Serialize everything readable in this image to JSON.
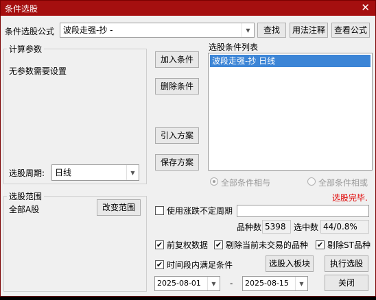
{
  "window": {
    "title": "条件选股",
    "close_glyph": "✕"
  },
  "formula": {
    "label": "条件选股公式",
    "value": "波段走强-抄  -",
    "find_button": "查找",
    "usage_button": "用法注释",
    "view_button": "查看公式"
  },
  "params": {
    "group_label": "计算参数",
    "none_text": "无参数需要设置",
    "period_label": "选股周期:",
    "period_value": "日线"
  },
  "actions": {
    "add_condition": "加入条件",
    "delete_condition": "删除条件",
    "import_plan": "引入方案",
    "save_plan": "保存方案"
  },
  "conditions": {
    "list_label": "选股条件列表",
    "items": [
      "波段走强-抄  日线"
    ],
    "all_and": "全部条件相与",
    "all_or": "全部条件相或",
    "status": "选股完毕."
  },
  "range": {
    "group_label": "选股范围",
    "value": "全部A股",
    "change_button": "改变范围"
  },
  "options": {
    "use_unfixed_period": "使用涨跌不定周期",
    "count_label": "品种数",
    "count_value": "5398",
    "selected_label": "选中数",
    "selected_value": "44/0.8%",
    "forward_adjust": "前复权数据",
    "exclude_untraded": "剔除当前未交易的品种",
    "exclude_st": "剔除ST品种",
    "period_satisfy": "时间段内满足条件",
    "to_board_button": "选股入板块",
    "run_button": "执行选股",
    "date_from": "2025-08-01",
    "date_sep": "-",
    "date_to": "2025-08-15",
    "close_button": "关闭",
    "check_glyph": "✔"
  }
}
